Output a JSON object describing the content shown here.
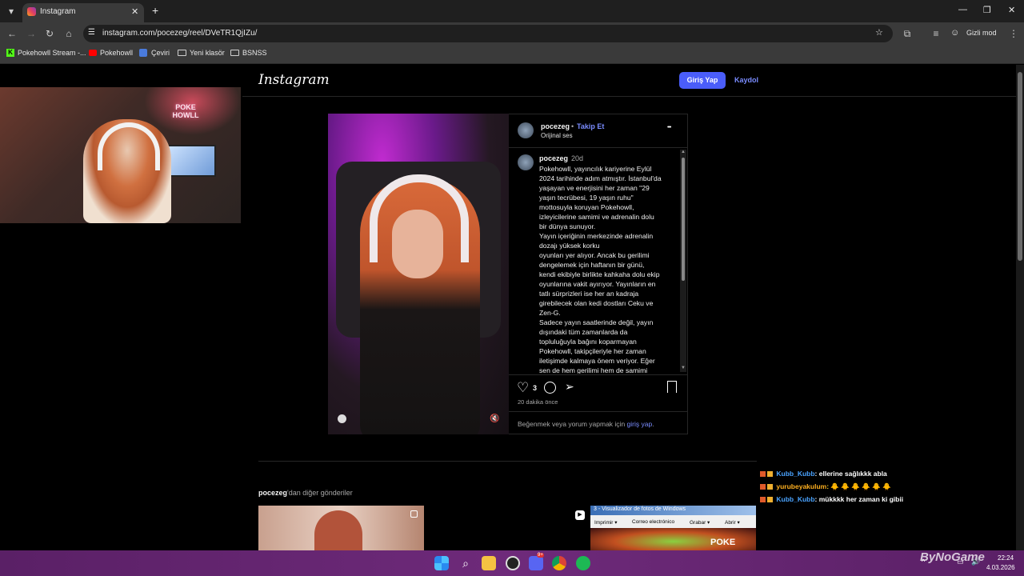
{
  "browser": {
    "tab_title": "Instagram",
    "new_tab": "+",
    "url": "instagram.com/pocezeg/reel/DVeTR1QjIZu/",
    "incognito_label": "Gizli mod",
    "bookmarks": [
      {
        "label": "Pokehowll Stream -...",
        "icon": "kick-icon"
      },
      {
        "label": "Pokehowll",
        "icon": "youtube-icon"
      },
      {
        "label": "Çeviri",
        "icon": "translate-icon"
      },
      {
        "label": "Yeni klasör",
        "icon": "folder-icon"
      },
      {
        "label": "BSNSS",
        "icon": "folder-icon"
      }
    ]
  },
  "webcam_overlay": {
    "sign_text": "POKE HOWLL"
  },
  "instagram": {
    "logo": "Instagram",
    "login_button": "Giriş Yap",
    "signup_link": "Kaydol",
    "post": {
      "username": "pocezeg",
      "follow_sep": "•",
      "follow_label": "Takip Et",
      "audio": "Orijinal ses",
      "more": "•••",
      "comment_user": "pocezeg",
      "comment_time": "20d",
      "caption_lines": [
        "Pokehowll, yayıncılık kariyerine Eylül",
        "2024 tarihinde adım atmıştır. İstanbul'da",
        "yaşayan ve enerjisini her zaman \"29",
        "yaşın tecrübesi, 19 yaşın ruhu\"",
        "mottosuyla koruyan Pokehowll,",
        "izleyicilerine samimi ve adrenalin dolu",
        "bir dünya sunuyor.",
        "Yayın içeriğinin merkezinde adrenalin",
        "dozajı yüksek korku",
        "oyunları yer alıyor. Ancak bu gerilimi",
        "dengelemek için haftanın bir günü,",
        "kendi ekibiyle birlikte kahkaha dolu ekip",
        "oyunlarına vakit ayırıyor. Yayınların en",
        "tatlı sürprizleri ise her an kadraja",
        "girebilecek olan kedi dostları Ceku ve",
        "Zen-G.",
        "Sadece yayın saatlerinde değil, yayın",
        "dışındaki tüm zamanlarda da",
        "topluluğuyla bağını koparmayan",
        "Pokehowll, takipçileriyle her zaman",
        "iletişimde kalmaya önem veriyor. Eğer",
        "sen de hem gerilimi hem de samimi"
      ],
      "like_count": "3",
      "posted_ago": "20 dakika önce",
      "login_prompt_prefix": "Beğenmek veya yorum yapmak için ",
      "login_prompt_link": "giriş yap",
      "login_prompt_suffix": "."
    },
    "more_posts_user": "pocezeg",
    "more_posts_suffix": "'dan diğer gönderiler",
    "thumb3_title": "3 - Visualizador de fotos de Windows",
    "thumb3_menu": [
      "Imprimir ▾",
      "Correo electrónico",
      "Grabar ▾",
      "Abrir ▾"
    ],
    "thumb3_sign": "POKE"
  },
  "chat": [
    {
      "user": "Kubb_Kubb",
      "text": ": ellerine sağlıkkk abla",
      "user_color": "#4aa3ff"
    },
    {
      "user": "yurubeyakulum",
      "text": ": 🐥 🐥 🐥 🐥 🐥 🐥",
      "user_color": "#ffb020"
    },
    {
      "user": "Kubb_Kubb",
      "text": ": mükkkk her zaman ki gibii",
      "user_color": "#4aa3ff"
    }
  ],
  "watermark": "ByNoGame",
  "taskbar": {
    "time": "22:24",
    "date": "4.03.2026",
    "discord_badge": "9+",
    "apps": [
      "windows-start-icon",
      "search-icon",
      "file-explorer-icon",
      "obs-icon",
      "discord-icon",
      "chrome-icon",
      "spotify-icon"
    ]
  },
  "colors": {
    "accent": "#4a5df9",
    "link": "#7a8cff",
    "taskbar": "#6e2a7a"
  }
}
